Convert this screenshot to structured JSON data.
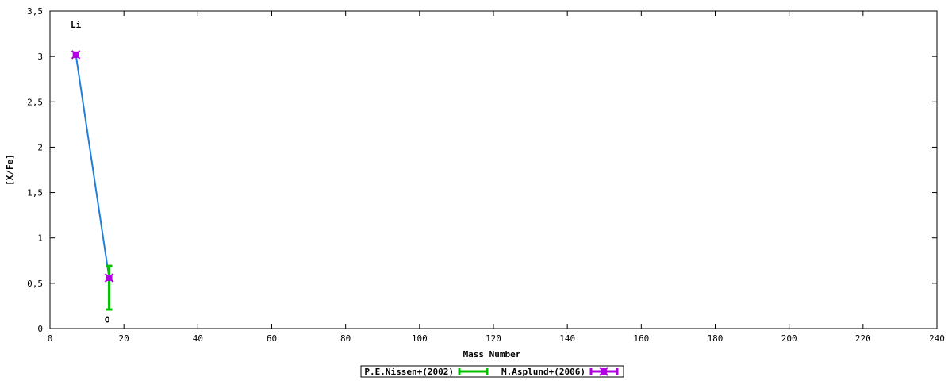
{
  "chart_data": {
    "type": "scatter",
    "xlabel": "Mass Number",
    "ylabel": "[X/Fe]",
    "xlim": [
      0,
      240
    ],
    "ylim": [
      0,
      3.5
    ],
    "x_ticks": [
      0,
      20,
      40,
      60,
      80,
      100,
      120,
      140,
      160,
      180,
      200,
      220,
      240
    ],
    "y_ticks": [
      0,
      0.5,
      1,
      1.5,
      2,
      2.5,
      3,
      3.5
    ],
    "y_tick_labels": [
      "0",
      "0,5",
      "1",
      "1,5",
      "2",
      "2,5",
      "3",
      "3,5"
    ],
    "grid": false,
    "legend_position": "bottom-center",
    "series": [
      {
        "name": "P.E.Nissen+(2002)",
        "color": "#00c000",
        "points": [
          {
            "x": 16,
            "y": 0.45,
            "yerr_low": 0.21,
            "yerr_high": 0.69
          }
        ]
      },
      {
        "name": "M.Asplund+(2006)",
        "color": "#b000e0",
        "points": [
          {
            "x": 7,
            "y": 3.02
          },
          {
            "x": 16,
            "y": 0.56
          }
        ]
      }
    ],
    "connecting_line": {
      "color": "#1f7fd8",
      "points": [
        {
          "x": 7,
          "y": 3.02
        },
        {
          "x": 16,
          "y": 0.56
        }
      ]
    },
    "annotations": [
      {
        "text": "Li",
        "x": 7,
        "y": 3.35
      },
      {
        "text": "O",
        "x": 15.5,
        "y": 0.1
      }
    ]
  }
}
